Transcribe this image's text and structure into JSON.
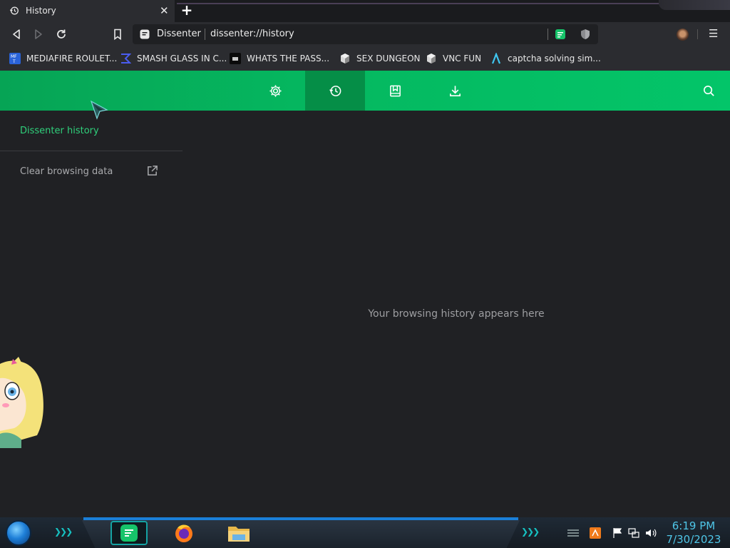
{
  "tab": {
    "title": "History",
    "close": "✕",
    "new_tab": "+"
  },
  "toolbar": {
    "site_label": "Dissenter",
    "url": "dissenter://history",
    "menu": "☰"
  },
  "bookmarks": [
    {
      "label": "MEDIAFIRE ROULET...",
      "icon": "mediafire-icon"
    },
    {
      "label": "SMASH GLASS IN C...",
      "icon": "sigma-icon"
    },
    {
      "label": "WHATS THE PASS...",
      "icon": "dark-site-icon"
    },
    {
      "label": "SEX DUNGEON",
      "icon": "cube-icon"
    },
    {
      "label": "VNC FUN",
      "icon": "cube-icon"
    },
    {
      "label": "captcha solving sim...",
      "icon": "lambda-icon"
    }
  ],
  "header": {
    "buttons": [
      "settings-icon",
      "history-icon",
      "bookmarks-icon",
      "downloads-icon",
      "search-icon"
    ],
    "active": "history-icon"
  },
  "sidebar": {
    "title": "Dissenter history",
    "clear_label": "Clear browsing data"
  },
  "main": {
    "empty_message": "Your browsing history appears here"
  },
  "taskbar": {
    "time": "6:19 PM",
    "date": "7/30/2023"
  },
  "colors": {
    "accent": "#05b860",
    "accent_dark": "#058e47",
    "sidebar_title": "#2fd07b",
    "clock": "#4fc6e8"
  }
}
